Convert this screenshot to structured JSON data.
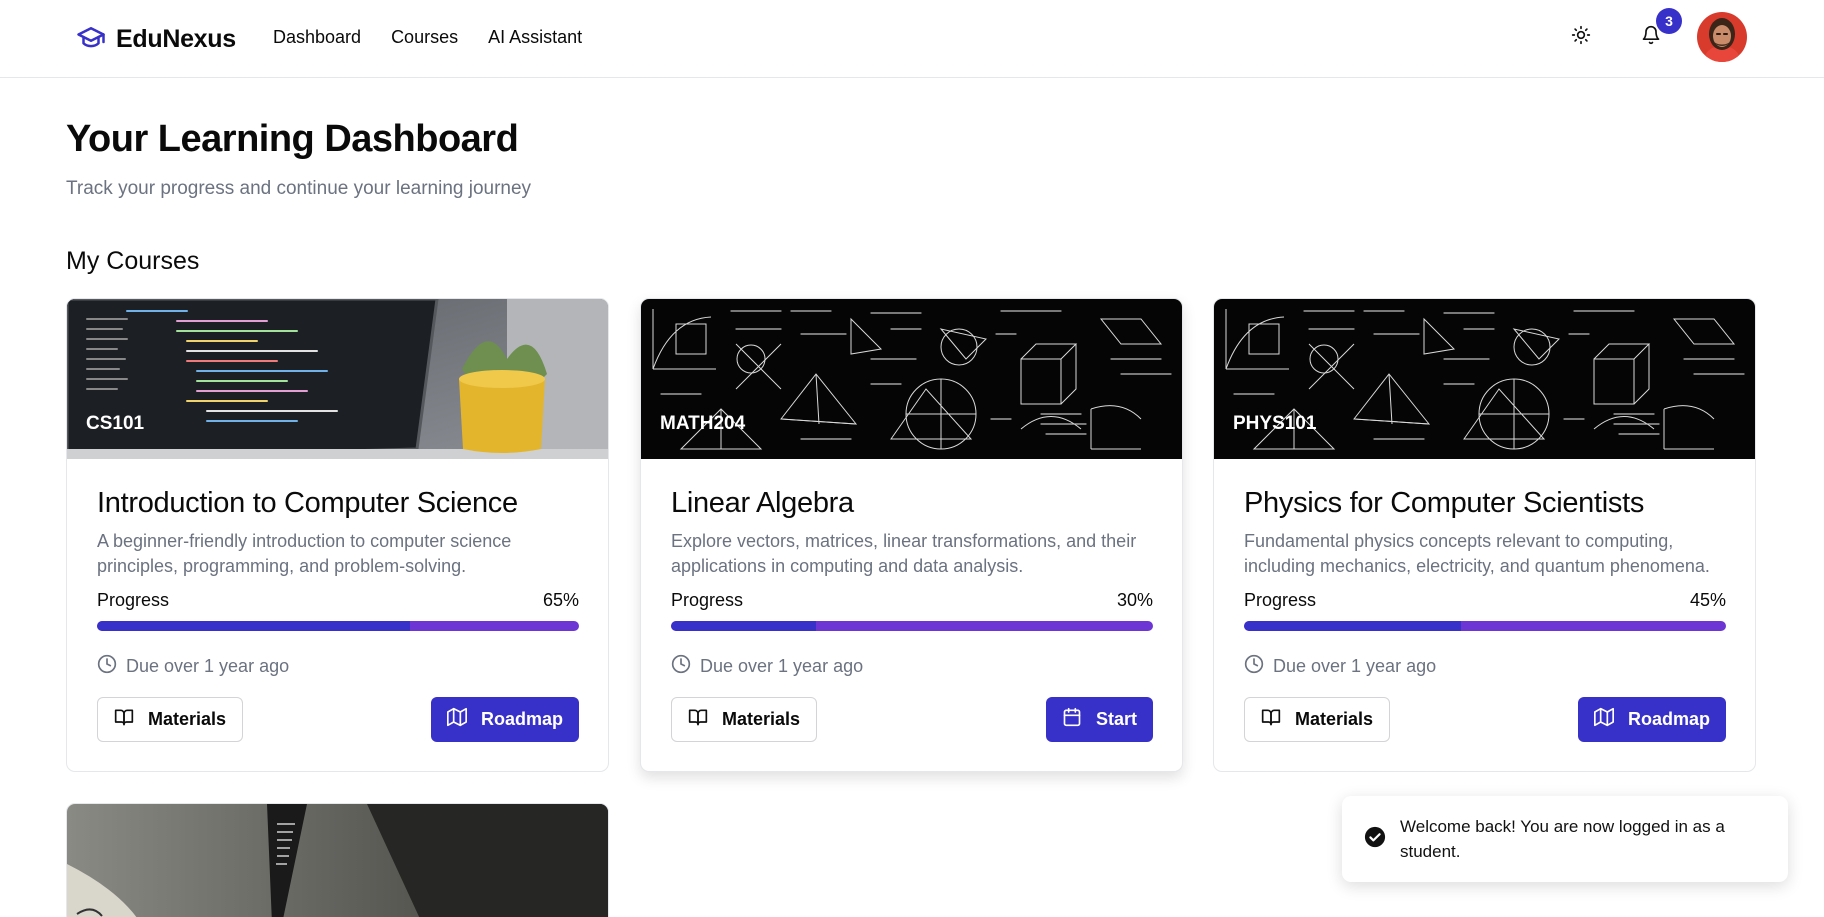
{
  "header": {
    "brand": "EduNexus",
    "nav": [
      "Dashboard",
      "Courses",
      "AI Assistant"
    ],
    "notification_count": "3",
    "icons": {
      "brand": "graduation-cap-icon",
      "theme": "sun-icon",
      "notifications": "bell-icon"
    },
    "accent_color": "#3730c9"
  },
  "page": {
    "title": "Your Learning Dashboard",
    "subtitle": "Track your progress and continue your learning journey",
    "section_title": "My Courses"
  },
  "courses": [
    {
      "code": "CS101",
      "title": "Introduction to Computer Science",
      "description": "A beginner-friendly introduction to computer science principles, programming, and problem-solving.",
      "progress_label": "Progress",
      "progress_text": "65%",
      "progress": 0.65,
      "due": "Due over 1 year ago",
      "materials_label": "Materials",
      "action_label": "Roadmap",
      "action_icon": "map-icon"
    },
    {
      "code": "MATH204",
      "title": "Linear Algebra",
      "description": "Explore vectors, matrices, linear transformations, and their applications in computing and data analysis.",
      "progress_label": "Progress",
      "progress_text": "30%",
      "progress": 0.3,
      "due": "Due over 1 year ago",
      "materials_label": "Materials",
      "action_label": "Start",
      "action_icon": "calendar-icon"
    },
    {
      "code": "PHYS101",
      "title": "Physics for Computer Scientists",
      "description": "Fundamental physics concepts relevant to computing, including mechanics, electricity, and quantum phenomena.",
      "progress_label": "Progress",
      "progress_text": "45%",
      "progress": 0.45,
      "due": "Due over 1 year ago",
      "materials_label": "Materials",
      "action_label": "Roadmap",
      "action_icon": "map-icon"
    }
  ],
  "toast": {
    "message": "Welcome back! You are now logged in as a student.",
    "icon": "check-circle-icon"
  }
}
